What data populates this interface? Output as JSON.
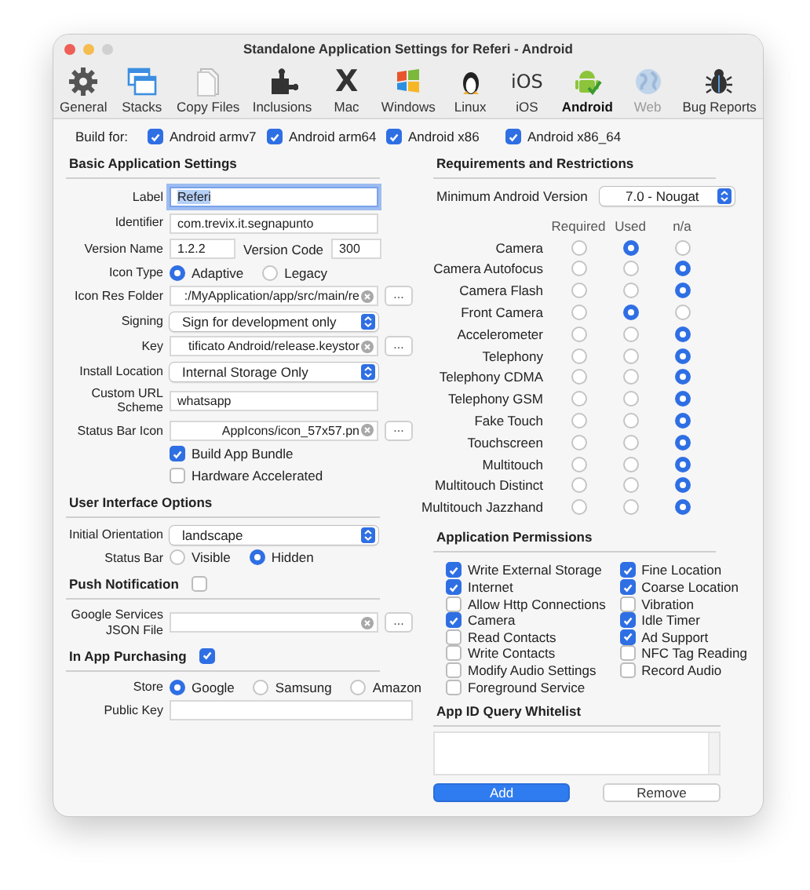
{
  "window": {
    "title": "Standalone Application Settings for Referi - Android"
  },
  "toolbar": [
    {
      "label": "General",
      "selected": false,
      "disabled": false
    },
    {
      "label": "Stacks",
      "selected": false,
      "disabled": false
    },
    {
      "label": "Copy Files",
      "selected": false,
      "disabled": false
    },
    {
      "label": "Inclusions",
      "selected": false,
      "disabled": false
    },
    {
      "label": "Mac",
      "glyph": "X",
      "selected": false,
      "disabled": false
    },
    {
      "label": "Windows",
      "selected": false,
      "disabled": false
    },
    {
      "label": "Linux",
      "selected": false,
      "disabled": false
    },
    {
      "label": "iOS",
      "glyph": "iOS",
      "selected": false,
      "disabled": false
    },
    {
      "label": "Android",
      "selected": true,
      "disabled": false
    },
    {
      "label": "Web",
      "selected": false,
      "disabled": true
    },
    {
      "label": "Bug Reports",
      "selected": false,
      "disabled": false
    }
  ],
  "build_for": {
    "label": "Build for:",
    "options": [
      {
        "label": "Android armv7",
        "checked": true
      },
      {
        "label": "Android arm64",
        "checked": true
      },
      {
        "label": "Android x86",
        "checked": true
      },
      {
        "label": "Android x86_64",
        "checked": true
      }
    ]
  },
  "left_sections": [
    {
      "heading": "Basic Application Settings",
      "rows": [
        {
          "kind": "text",
          "label": "Label",
          "value": "Referi",
          "focused": true
        },
        {
          "kind": "text",
          "label": "Identifier",
          "value": "com.trevix.it.segnapunto",
          "focused": false
        },
        {
          "kind": "version",
          "label": "Version Name",
          "value": "1.2.2",
          "label_2": "Version Code",
          "value_2": "300"
        },
        {
          "kind": "radio",
          "label": "Icon Type",
          "options": [
            {
              "label": "Adaptive",
              "selected": true
            },
            {
              "label": "Legacy",
              "selected": false
            }
          ]
        },
        {
          "kind": "file",
          "label": "Icon Res Folder",
          "value": ":/MyApplication/app/src/main/re",
          "button": "..."
        },
        {
          "kind": "select",
          "label": "Signing",
          "value": "Sign for development only"
        },
        {
          "kind": "file",
          "label": "Key",
          "value": "tificato Android/release.keystor",
          "button": "..."
        },
        {
          "kind": "select",
          "label": "Install Location",
          "value": "Internal Storage Only"
        },
        {
          "kind": "text",
          "label": "Custom URL Scheme",
          "value": "whatsapp",
          "focused": false
        },
        {
          "kind": "file",
          "label": "Status Bar Icon",
          "value": "AppIcons/icon_57x57.pn",
          "button": "..."
        },
        {
          "kind": "check",
          "label": "Build App Bundle",
          "checked": true
        },
        {
          "kind": "check",
          "label": "Hardware Accelerated",
          "checked": false
        }
      ]
    },
    {
      "heading": "User Interface Options",
      "rows": [
        {
          "kind": "select",
          "label": "Initial Orientation",
          "value": "landscape"
        },
        {
          "kind": "radio",
          "label": "Status Bar",
          "options": [
            {
              "label": "Visible",
              "selected": false
            },
            {
              "label": "Hidden",
              "selected": true
            }
          ]
        }
      ]
    },
    {
      "heading": "Push Notification",
      "checked": false,
      "rows": [
        {
          "kind": "file",
          "label": "Google Services JSON File",
          "button": "..."
        }
      ]
    },
    {
      "heading": "In App Purchasing",
      "checked": true,
      "rows": [
        {
          "kind": "radio",
          "label": "Store",
          "options": [
            {
              "label": "Google",
              "selected": true
            },
            {
              "label": "Samsung",
              "selected": false
            },
            {
              "label": "Amazon",
              "selected": false
            }
          ]
        },
        {
          "kind": "text",
          "label": "Public Key",
          "focused": false
        }
      ]
    }
  ],
  "requirements": {
    "heading": "Requirements and Restrictions",
    "min_version": {
      "label": "Minimum Android Version",
      "value": "7.0 - Nougat"
    },
    "columns": [
      "Required",
      "Used",
      "n/a"
    ],
    "features": [
      {
        "name": "Camera",
        "options": [
          {
            "selected": false
          },
          {
            "selected": true
          },
          {
            "selected": false
          }
        ]
      },
      {
        "name": "Camera Autofocus",
        "options": [
          {
            "selected": false
          },
          {
            "selected": false
          },
          {
            "selected": true
          }
        ]
      },
      {
        "name": "Camera Flash",
        "options": [
          {
            "selected": false
          },
          {
            "selected": false
          },
          {
            "selected": true
          }
        ]
      },
      {
        "name": "Front Camera",
        "options": [
          {
            "selected": false
          },
          {
            "selected": true
          },
          {
            "selected": false
          }
        ]
      },
      {
        "name": "Accelerometer",
        "options": [
          {
            "selected": false
          },
          {
            "selected": false
          },
          {
            "selected": true
          }
        ]
      },
      {
        "name": "Telephony",
        "options": [
          {
            "selected": false
          },
          {
            "selected": false
          },
          {
            "selected": true
          }
        ]
      },
      {
        "name": "Telephony CDMA",
        "options": [
          {
            "selected": false
          },
          {
            "selected": false
          },
          {
            "selected": true
          }
        ]
      },
      {
        "name": "Telephony GSM",
        "options": [
          {
            "selected": false
          },
          {
            "selected": false
          },
          {
            "selected": true
          }
        ]
      },
      {
        "name": "Fake Touch",
        "options": [
          {
            "selected": false
          },
          {
            "selected": false
          },
          {
            "selected": true
          }
        ]
      },
      {
        "name": "Touchscreen",
        "options": [
          {
            "selected": false
          },
          {
            "selected": false
          },
          {
            "selected": true
          }
        ]
      },
      {
        "name": "Multitouch",
        "options": [
          {
            "selected": false
          },
          {
            "selected": false
          },
          {
            "selected": true
          }
        ]
      },
      {
        "name": "Multitouch Distinct",
        "options": [
          {
            "selected": false
          },
          {
            "selected": false
          },
          {
            "selected": true
          }
        ]
      },
      {
        "name": "Multitouch Jazzhand",
        "options": [
          {
            "selected": false
          },
          {
            "selected": false
          },
          {
            "selected": true
          }
        ]
      }
    ]
  },
  "permissions": {
    "heading": "Application Permissions",
    "columns": [
      [
        {
          "label": "Write External Storage",
          "checked": true
        },
        {
          "label": "Internet",
          "checked": true
        },
        {
          "label": "Allow Http Connections",
          "checked": false
        },
        {
          "label": "Camera",
          "checked": true
        },
        {
          "label": "Read Contacts",
          "checked": false
        },
        {
          "label": "Write Contacts",
          "checked": false
        },
        {
          "label": "Modify Audio Settings",
          "checked": false
        },
        {
          "label": "Foreground Service",
          "checked": false
        }
      ],
      [
        {
          "label": "Fine Location",
          "checked": true
        },
        {
          "label": "Coarse Location",
          "checked": true
        },
        {
          "label": "Vibration",
          "checked": false
        },
        {
          "label": "Idle Timer",
          "checked": true
        },
        {
          "label": "Ad Support",
          "checked": true
        },
        {
          "label": "NFC Tag Reading",
          "checked": false
        },
        {
          "label": "Record Audio",
          "checked": false
        }
      ]
    ]
  },
  "whitelist": {
    "heading": "App ID Query Whitelist",
    "buttons": [
      {
        "label": "Add",
        "default": true
      },
      {
        "label": "Remove",
        "default": false
      }
    ]
  }
}
